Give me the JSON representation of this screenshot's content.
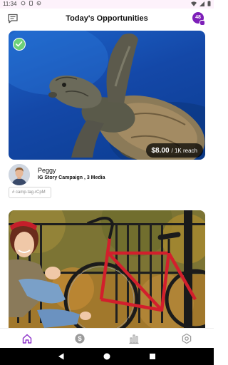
{
  "status_bar": {
    "time": "11:34",
    "left_icons": [
      "sync-icon",
      "phone-icon",
      "location-icon"
    ],
    "right_icons": [
      "wifi-icon",
      "signal-icon",
      "battery-icon"
    ]
  },
  "header": {
    "title": "Today's Opportunities",
    "notification_count": "48",
    "accent_color": "#7d1fb8"
  },
  "opportunities": [
    {
      "image": "sea-turtle-photo",
      "selected": true,
      "price": "$8.00",
      "reach": "/ 1K reach",
      "influencer_name": "Peggy",
      "campaign": "IG Story Campaign , 3 Media",
      "tag": "# camp-tag-rCpM"
    },
    {
      "image": "woman-with-bicycle-photo"
    }
  ],
  "bottom_nav": [
    {
      "icon": "home-icon",
      "active": true
    },
    {
      "icon": "dollar-icon",
      "active": false
    },
    {
      "icon": "bar-chart-icon",
      "active": false
    },
    {
      "icon": "gear-icon",
      "active": false
    }
  ],
  "system_nav": [
    "back-icon",
    "home-circle-icon",
    "recents-icon"
  ]
}
